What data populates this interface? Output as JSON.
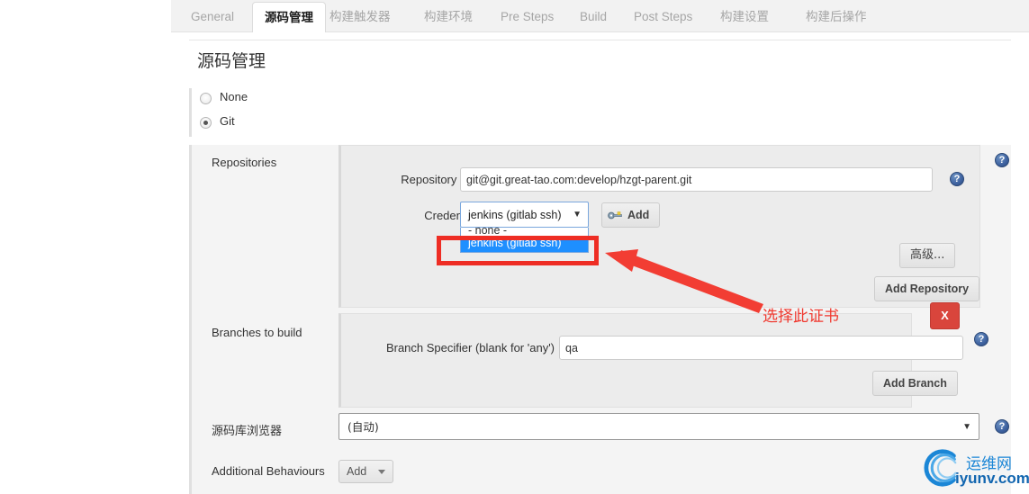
{
  "tabs": [
    {
      "label": "General",
      "active": false
    },
    {
      "label": "源码管理",
      "active": true
    },
    {
      "label": "构建触发器",
      "active": false
    },
    {
      "label": "构建环境",
      "active": false
    },
    {
      "label": "Pre Steps",
      "active": false
    },
    {
      "label": "Build",
      "active": false
    },
    {
      "label": "Post Steps",
      "active": false
    },
    {
      "label": "构建设置",
      "active": false
    },
    {
      "label": "构建后操作",
      "active": false
    }
  ],
  "page": {
    "title": "源码管理"
  },
  "scm_options": [
    {
      "label": "None",
      "checked": false
    },
    {
      "label": "Git",
      "checked": true
    }
  ],
  "repositories": {
    "section_label": "Repositories",
    "repository_url": {
      "label": "Repository URL",
      "value": "git@git.great-tao.com:develop/hzgt-parent.git"
    },
    "credentials": {
      "label": "Credentials",
      "selected": "jenkins (gitlab ssh)",
      "options": [
        {
          "label": "- none -",
          "selected": false
        },
        {
          "label": "jenkins (gitlab ssh)",
          "selected": true
        }
      ],
      "add_button": "Add"
    },
    "advanced_button": "高级...",
    "add_repository_button": "Add Repository"
  },
  "branches": {
    "section_label": "Branches to build",
    "branch_specifier": {
      "label": "Branch Specifier (blank for 'any')",
      "value": "qa"
    },
    "add_branch_button": "Add Branch",
    "delete_button": "X"
  },
  "repo_browser": {
    "label": "源码库浏览器",
    "selected": "(自动)"
  },
  "additional_behaviours": {
    "label": "Additional Behaviours",
    "add_button": "Add"
  },
  "annotation": {
    "text": "选择此证书",
    "color": "#f0392f"
  },
  "watermark": {
    "top_text": "运维网",
    "bottom_text": "iyunv.com"
  },
  "colors": {
    "accent_red": "#ee2d24",
    "select_highlight": "#1e8fff",
    "delete_red": "#d9453c",
    "help_blue": "#3e62a0"
  }
}
